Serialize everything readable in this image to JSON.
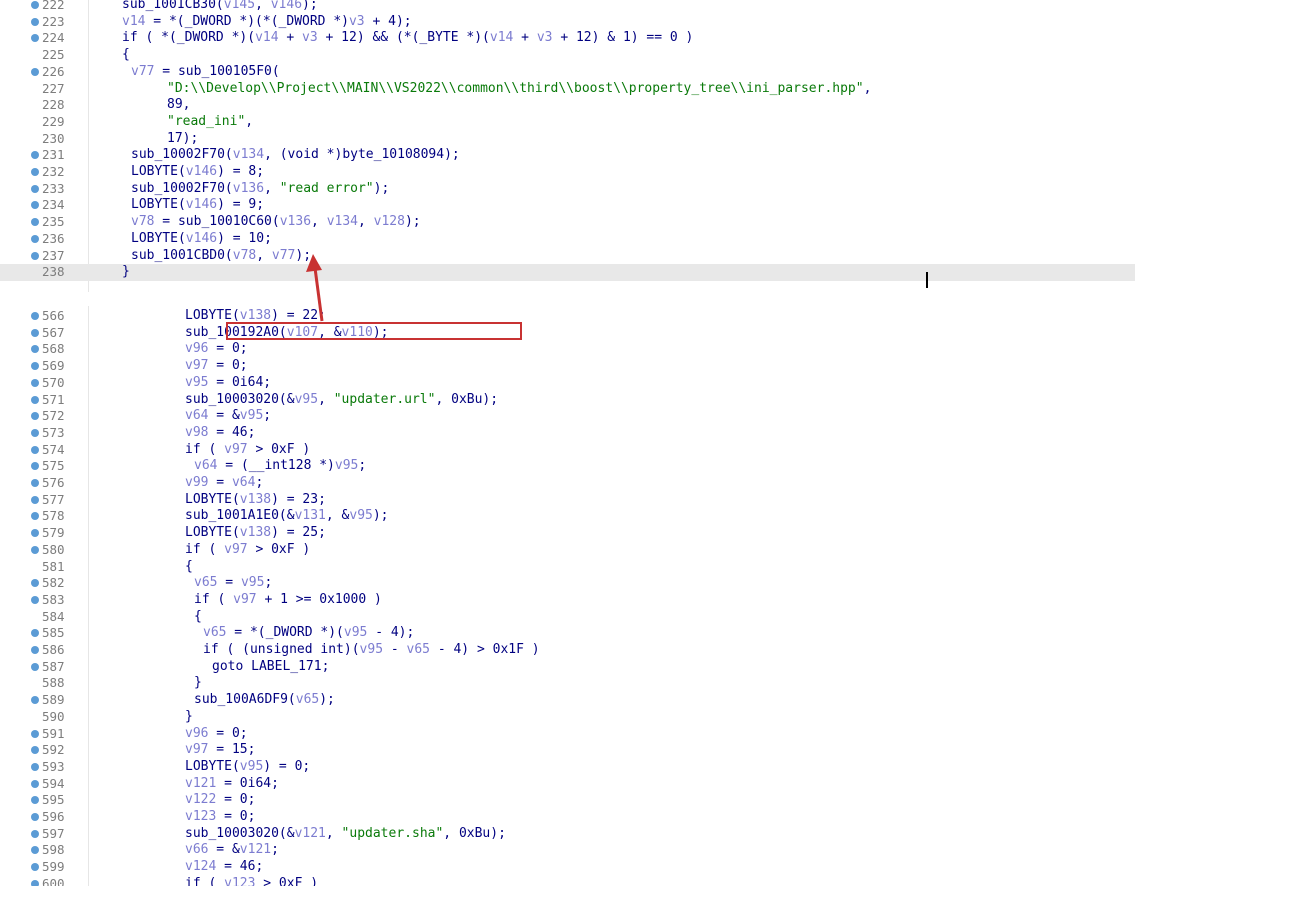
{
  "top_pane": {
    "lines": [
      {
        "n": "222",
        "bp": true,
        "indent": 4,
        "tokens": [
          [
            "sub_1001CB30(",
            ""
          ],
          [
            "v145",
            "v"
          ],
          [
            ", ",
            ""
          ],
          [
            "v146",
            "v"
          ],
          [
            ");",
            ""
          ]
        ]
      },
      {
        "n": "223",
        "bp": true,
        "indent": 4,
        "tokens": [
          [
            "v14",
            "v"
          ],
          [
            " = *(_DWORD *)(*(_DWORD *)",
            ""
          ],
          [
            "v3",
            "v"
          ],
          [
            " + 4);",
            ""
          ]
        ]
      },
      {
        "n": "224",
        "bp": true,
        "indent": 4,
        "tokens": [
          [
            "if ( *(_DWORD *)(",
            ""
          ],
          [
            "v14",
            "v"
          ],
          [
            " + ",
            ""
          ],
          [
            "v3",
            "v"
          ],
          [
            " + 12) && (*(_BYTE *)(",
            ""
          ],
          [
            "v14",
            "v"
          ],
          [
            " + ",
            ""
          ],
          [
            "v3",
            "v"
          ],
          [
            " + 12) & 1) == 0 )",
            ""
          ]
        ]
      },
      {
        "n": "225",
        "bp": false,
        "indent": 4,
        "tokens": [
          [
            "{",
            ""
          ]
        ]
      },
      {
        "n": "226",
        "bp": true,
        "indent": 6,
        "tokens": [
          [
            "v77",
            "v"
          ],
          [
            " = sub_100105F0(",
            ""
          ]
        ]
      },
      {
        "n": "227",
        "bp": false,
        "indent": 14,
        "tokens": [
          [
            "\"D:\\\\Develop\\\\Project\\\\MAIN\\\\VS2022\\\\common\\\\third\\\\boost\\\\property_tree\\\\ini_parser.hpp\"",
            "s"
          ],
          [
            ",",
            ""
          ]
        ]
      },
      {
        "n": "228",
        "bp": false,
        "indent": 14,
        "tokens": [
          [
            "89,",
            ""
          ]
        ]
      },
      {
        "n": "229",
        "bp": false,
        "indent": 14,
        "tokens": [
          [
            "\"read_ini\"",
            "s"
          ],
          [
            ",",
            ""
          ]
        ]
      },
      {
        "n": "230",
        "bp": false,
        "indent": 14,
        "tokens": [
          [
            "17);",
            ""
          ]
        ]
      },
      {
        "n": "231",
        "bp": true,
        "indent": 6,
        "tokens": [
          [
            "sub_10002F70(",
            ""
          ],
          [
            "v134",
            "v"
          ],
          [
            ", (void *)byte_10108094);",
            ""
          ]
        ]
      },
      {
        "n": "232",
        "bp": true,
        "indent": 6,
        "tokens": [
          [
            "LOBYTE(",
            ""
          ],
          [
            "v146",
            "v"
          ],
          [
            ") = 8;",
            ""
          ]
        ]
      },
      {
        "n": "233",
        "bp": true,
        "indent": 6,
        "tokens": [
          [
            "sub_10002F70(",
            ""
          ],
          [
            "v136",
            "v"
          ],
          [
            ", ",
            ""
          ],
          [
            "\"read error\"",
            "s"
          ],
          [
            ");",
            ""
          ]
        ]
      },
      {
        "n": "234",
        "bp": true,
        "indent": 6,
        "tokens": [
          [
            "LOBYTE(",
            ""
          ],
          [
            "v146",
            "v"
          ],
          [
            ") = 9;",
            ""
          ]
        ]
      },
      {
        "n": "235",
        "bp": true,
        "indent": 6,
        "tokens": [
          [
            "v78",
            "v"
          ],
          [
            " = sub_10010C60(",
            ""
          ],
          [
            "v136",
            "v"
          ],
          [
            ", ",
            ""
          ],
          [
            "v134",
            "v"
          ],
          [
            ", ",
            ""
          ],
          [
            "v128",
            "v"
          ],
          [
            ");",
            ""
          ]
        ]
      },
      {
        "n": "236",
        "bp": true,
        "indent": 6,
        "tokens": [
          [
            "LOBYTE(",
            ""
          ],
          [
            "v146",
            "v"
          ],
          [
            ") = 10;",
            ""
          ]
        ]
      },
      {
        "n": "237",
        "bp": true,
        "indent": 6,
        "tokens": [
          [
            "sub_1001CBD0(",
            ""
          ],
          [
            "v78",
            "v"
          ],
          [
            ", ",
            ""
          ],
          [
            "v77",
            "v"
          ],
          [
            ");",
            ""
          ]
        ]
      },
      {
        "n": "238",
        "bp": false,
        "indent": 4,
        "current": true,
        "tokens": [
          [
            "}",
            ""
          ]
        ]
      }
    ]
  },
  "bottom_pane": {
    "lines": [
      {
        "n": "566",
        "bp": true,
        "indent": 18,
        "tokens": [
          [
            "LOBYTE(",
            ""
          ],
          [
            "v138",
            "v"
          ],
          [
            ") = 22;",
            ""
          ]
        ]
      },
      {
        "n": "567",
        "bp": true,
        "indent": 18,
        "tokens": [
          [
            "sub_100192A0(",
            ""
          ],
          [
            "v107",
            "v"
          ],
          [
            ", &",
            ""
          ],
          [
            "v110",
            "v"
          ],
          [
            ");",
            ""
          ]
        ]
      },
      {
        "n": "568",
        "bp": true,
        "indent": 18,
        "tokens": [
          [
            "v96",
            "v"
          ],
          [
            " = 0;",
            ""
          ]
        ]
      },
      {
        "n": "569",
        "bp": true,
        "indent": 18,
        "tokens": [
          [
            "v97",
            "v"
          ],
          [
            " = 0;",
            ""
          ]
        ]
      },
      {
        "n": "570",
        "bp": true,
        "indent": 18,
        "tokens": [
          [
            "v95",
            "v"
          ],
          [
            " = 0i64;",
            ""
          ]
        ]
      },
      {
        "n": "571",
        "bp": true,
        "indent": 18,
        "tokens": [
          [
            "sub_10003020(&",
            ""
          ],
          [
            "v95",
            "v"
          ],
          [
            ", ",
            ""
          ],
          [
            "\"updater.url\"",
            "s"
          ],
          [
            ", 0xBu);",
            ""
          ]
        ]
      },
      {
        "n": "572",
        "bp": true,
        "indent": 18,
        "tokens": [
          [
            "v64",
            "v"
          ],
          [
            " = &",
            ""
          ],
          [
            "v95",
            "v"
          ],
          [
            ";",
            ""
          ]
        ]
      },
      {
        "n": "573",
        "bp": true,
        "indent": 18,
        "tokens": [
          [
            "v98",
            "v"
          ],
          [
            " = 46;",
            ""
          ]
        ]
      },
      {
        "n": "574",
        "bp": true,
        "indent": 18,
        "tokens": [
          [
            "if ( ",
            ""
          ],
          [
            "v97",
            "v"
          ],
          [
            " > 0xF )",
            ""
          ]
        ]
      },
      {
        "n": "575",
        "bp": true,
        "indent": 20,
        "tokens": [
          [
            "v64",
            "v"
          ],
          [
            " = (__int128 *)",
            ""
          ],
          [
            "v95",
            "v"
          ],
          [
            ";",
            ""
          ]
        ]
      },
      {
        "n": "576",
        "bp": true,
        "indent": 18,
        "tokens": [
          [
            "v99",
            "v"
          ],
          [
            " = ",
            ""
          ],
          [
            "v64",
            "v"
          ],
          [
            ";",
            ""
          ]
        ]
      },
      {
        "n": "577",
        "bp": true,
        "indent": 18,
        "tokens": [
          [
            "LOBYTE(",
            ""
          ],
          [
            "v138",
            "v"
          ],
          [
            ") = 23;",
            ""
          ]
        ]
      },
      {
        "n": "578",
        "bp": true,
        "indent": 18,
        "tokens": [
          [
            "sub_1001A1E0(&",
            ""
          ],
          [
            "v131",
            "v"
          ],
          [
            ", &",
            ""
          ],
          [
            "v95",
            "v"
          ],
          [
            ");",
            ""
          ]
        ]
      },
      {
        "n": "579",
        "bp": true,
        "indent": 18,
        "tokens": [
          [
            "LOBYTE(",
            ""
          ],
          [
            "v138",
            "v"
          ],
          [
            ") = 25;",
            ""
          ]
        ]
      },
      {
        "n": "580",
        "bp": true,
        "indent": 18,
        "tokens": [
          [
            "if ( ",
            ""
          ],
          [
            "v97",
            "v"
          ],
          [
            " > 0xF )",
            ""
          ]
        ]
      },
      {
        "n": "581",
        "bp": false,
        "indent": 18,
        "tokens": [
          [
            "{",
            ""
          ]
        ]
      },
      {
        "n": "582",
        "bp": true,
        "indent": 20,
        "tokens": [
          [
            "v65",
            "v"
          ],
          [
            " = ",
            ""
          ],
          [
            "v95",
            "v"
          ],
          [
            ";",
            ""
          ]
        ]
      },
      {
        "n": "583",
        "bp": true,
        "indent": 20,
        "tokens": [
          [
            "if ( ",
            ""
          ],
          [
            "v97",
            "v"
          ],
          [
            " + 1 >= 0x1000 )",
            ""
          ]
        ]
      },
      {
        "n": "584",
        "bp": false,
        "indent": 20,
        "tokens": [
          [
            "{",
            ""
          ]
        ]
      },
      {
        "n": "585",
        "bp": true,
        "indent": 22,
        "tokens": [
          [
            "v65",
            "v"
          ],
          [
            " = *(_DWORD *)(",
            ""
          ],
          [
            "v95",
            "v"
          ],
          [
            " - 4);",
            ""
          ]
        ]
      },
      {
        "n": "586",
        "bp": true,
        "indent": 22,
        "tokens": [
          [
            "if ( (unsigned int)(",
            ""
          ],
          [
            "v95",
            "v"
          ],
          [
            " - ",
            ""
          ],
          [
            "v65",
            "v"
          ],
          [
            " - 4) > 0x1F )",
            ""
          ]
        ]
      },
      {
        "n": "587",
        "bp": true,
        "indent": 24,
        "tokens": [
          [
            "goto LABEL_171;",
            ""
          ]
        ]
      },
      {
        "n": "588",
        "bp": false,
        "indent": 20,
        "tokens": [
          [
            "}",
            ""
          ]
        ]
      },
      {
        "n": "589",
        "bp": true,
        "indent": 20,
        "tokens": [
          [
            "sub_100A6DF9(",
            ""
          ],
          [
            "v65",
            "v"
          ],
          [
            ");",
            ""
          ]
        ]
      },
      {
        "n": "590",
        "bp": false,
        "indent": 18,
        "tokens": [
          [
            "}",
            ""
          ]
        ]
      },
      {
        "n": "591",
        "bp": true,
        "indent": 18,
        "tokens": [
          [
            "v96",
            "v"
          ],
          [
            " = 0;",
            ""
          ]
        ]
      },
      {
        "n": "592",
        "bp": true,
        "indent": 18,
        "tokens": [
          [
            "v97",
            "v"
          ],
          [
            " = 15;",
            ""
          ]
        ]
      },
      {
        "n": "593",
        "bp": true,
        "indent": 18,
        "tokens": [
          [
            "LOBYTE(",
            ""
          ],
          [
            "v95",
            "v"
          ],
          [
            ") = 0;",
            ""
          ]
        ]
      },
      {
        "n": "594",
        "bp": true,
        "indent": 18,
        "tokens": [
          [
            "v121",
            "v"
          ],
          [
            " = 0i64;",
            ""
          ]
        ]
      },
      {
        "n": "595",
        "bp": true,
        "indent": 18,
        "tokens": [
          [
            "v122",
            "v"
          ],
          [
            " = 0;",
            ""
          ]
        ]
      },
      {
        "n": "596",
        "bp": true,
        "indent": 18,
        "tokens": [
          [
            "v123",
            "v"
          ],
          [
            " = 0;",
            ""
          ]
        ]
      },
      {
        "n": "597",
        "bp": true,
        "indent": 18,
        "tokens": [
          [
            "sub_10003020(&",
            ""
          ],
          [
            "v121",
            "v"
          ],
          [
            ", ",
            ""
          ],
          [
            "\"updater.sha\"",
            "s"
          ],
          [
            ", 0xBu);",
            ""
          ]
        ]
      },
      {
        "n": "598",
        "bp": true,
        "indent": 18,
        "tokens": [
          [
            "v66",
            "v"
          ],
          [
            " = &",
            ""
          ],
          [
            "v121",
            "v"
          ],
          [
            ";",
            ""
          ]
        ]
      },
      {
        "n": "599",
        "bp": true,
        "indent": 18,
        "tokens": [
          [
            "v124",
            "v"
          ],
          [
            " = 46;",
            ""
          ]
        ]
      },
      {
        "n": "600",
        "bp": true,
        "indent": 18,
        "tokens": [
          [
            "if ( ",
            ""
          ],
          [
            "v123",
            "v"
          ],
          [
            " > 0xF )",
            ""
          ]
        ]
      }
    ]
  },
  "colors": {
    "identifier": "#000080",
    "variable": "#7c7cd0",
    "string": "#0a7a0a",
    "annotation": "#c83232",
    "breakpoint": "#5b9bd5"
  }
}
